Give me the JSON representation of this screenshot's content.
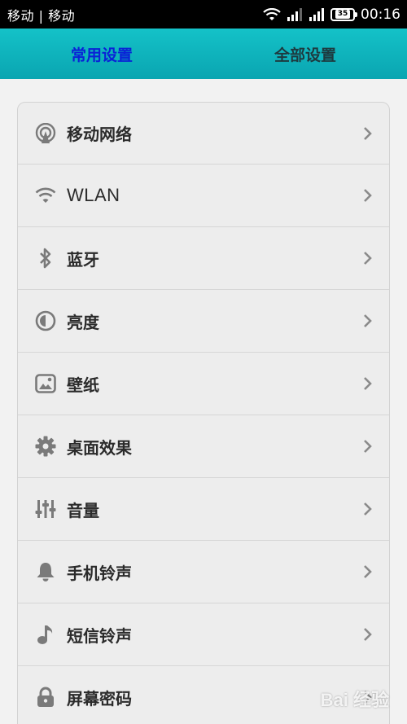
{
  "status_bar": {
    "carrier": "移动 | 移动",
    "battery": "35",
    "time": "00:16"
  },
  "tabs": [
    {
      "label": "常用设置",
      "active": true
    },
    {
      "label": "全部设置",
      "active": false
    }
  ],
  "settings": [
    {
      "label": "移动网络",
      "icon": "cellular-network-icon"
    },
    {
      "label": "WLAN",
      "icon": "wifi-icon"
    },
    {
      "label": "蓝牙",
      "icon": "bluetooth-icon"
    },
    {
      "label": "亮度",
      "icon": "brightness-icon"
    },
    {
      "label": "壁纸",
      "icon": "wallpaper-icon"
    },
    {
      "label": "桌面效果",
      "icon": "gear-icon"
    },
    {
      "label": "音量",
      "icon": "volume-sliders-icon"
    },
    {
      "label": "手机铃声",
      "icon": "bell-icon"
    },
    {
      "label": "短信铃声",
      "icon": "music-note-icon"
    },
    {
      "label": "屏幕密码",
      "icon": "lock-icon"
    }
  ],
  "colors": {
    "tab_bar": "#0fb4bd",
    "active_tab": "#0a22d6",
    "icon": "#7a7a7a"
  },
  "watermark": "Bai 经验"
}
